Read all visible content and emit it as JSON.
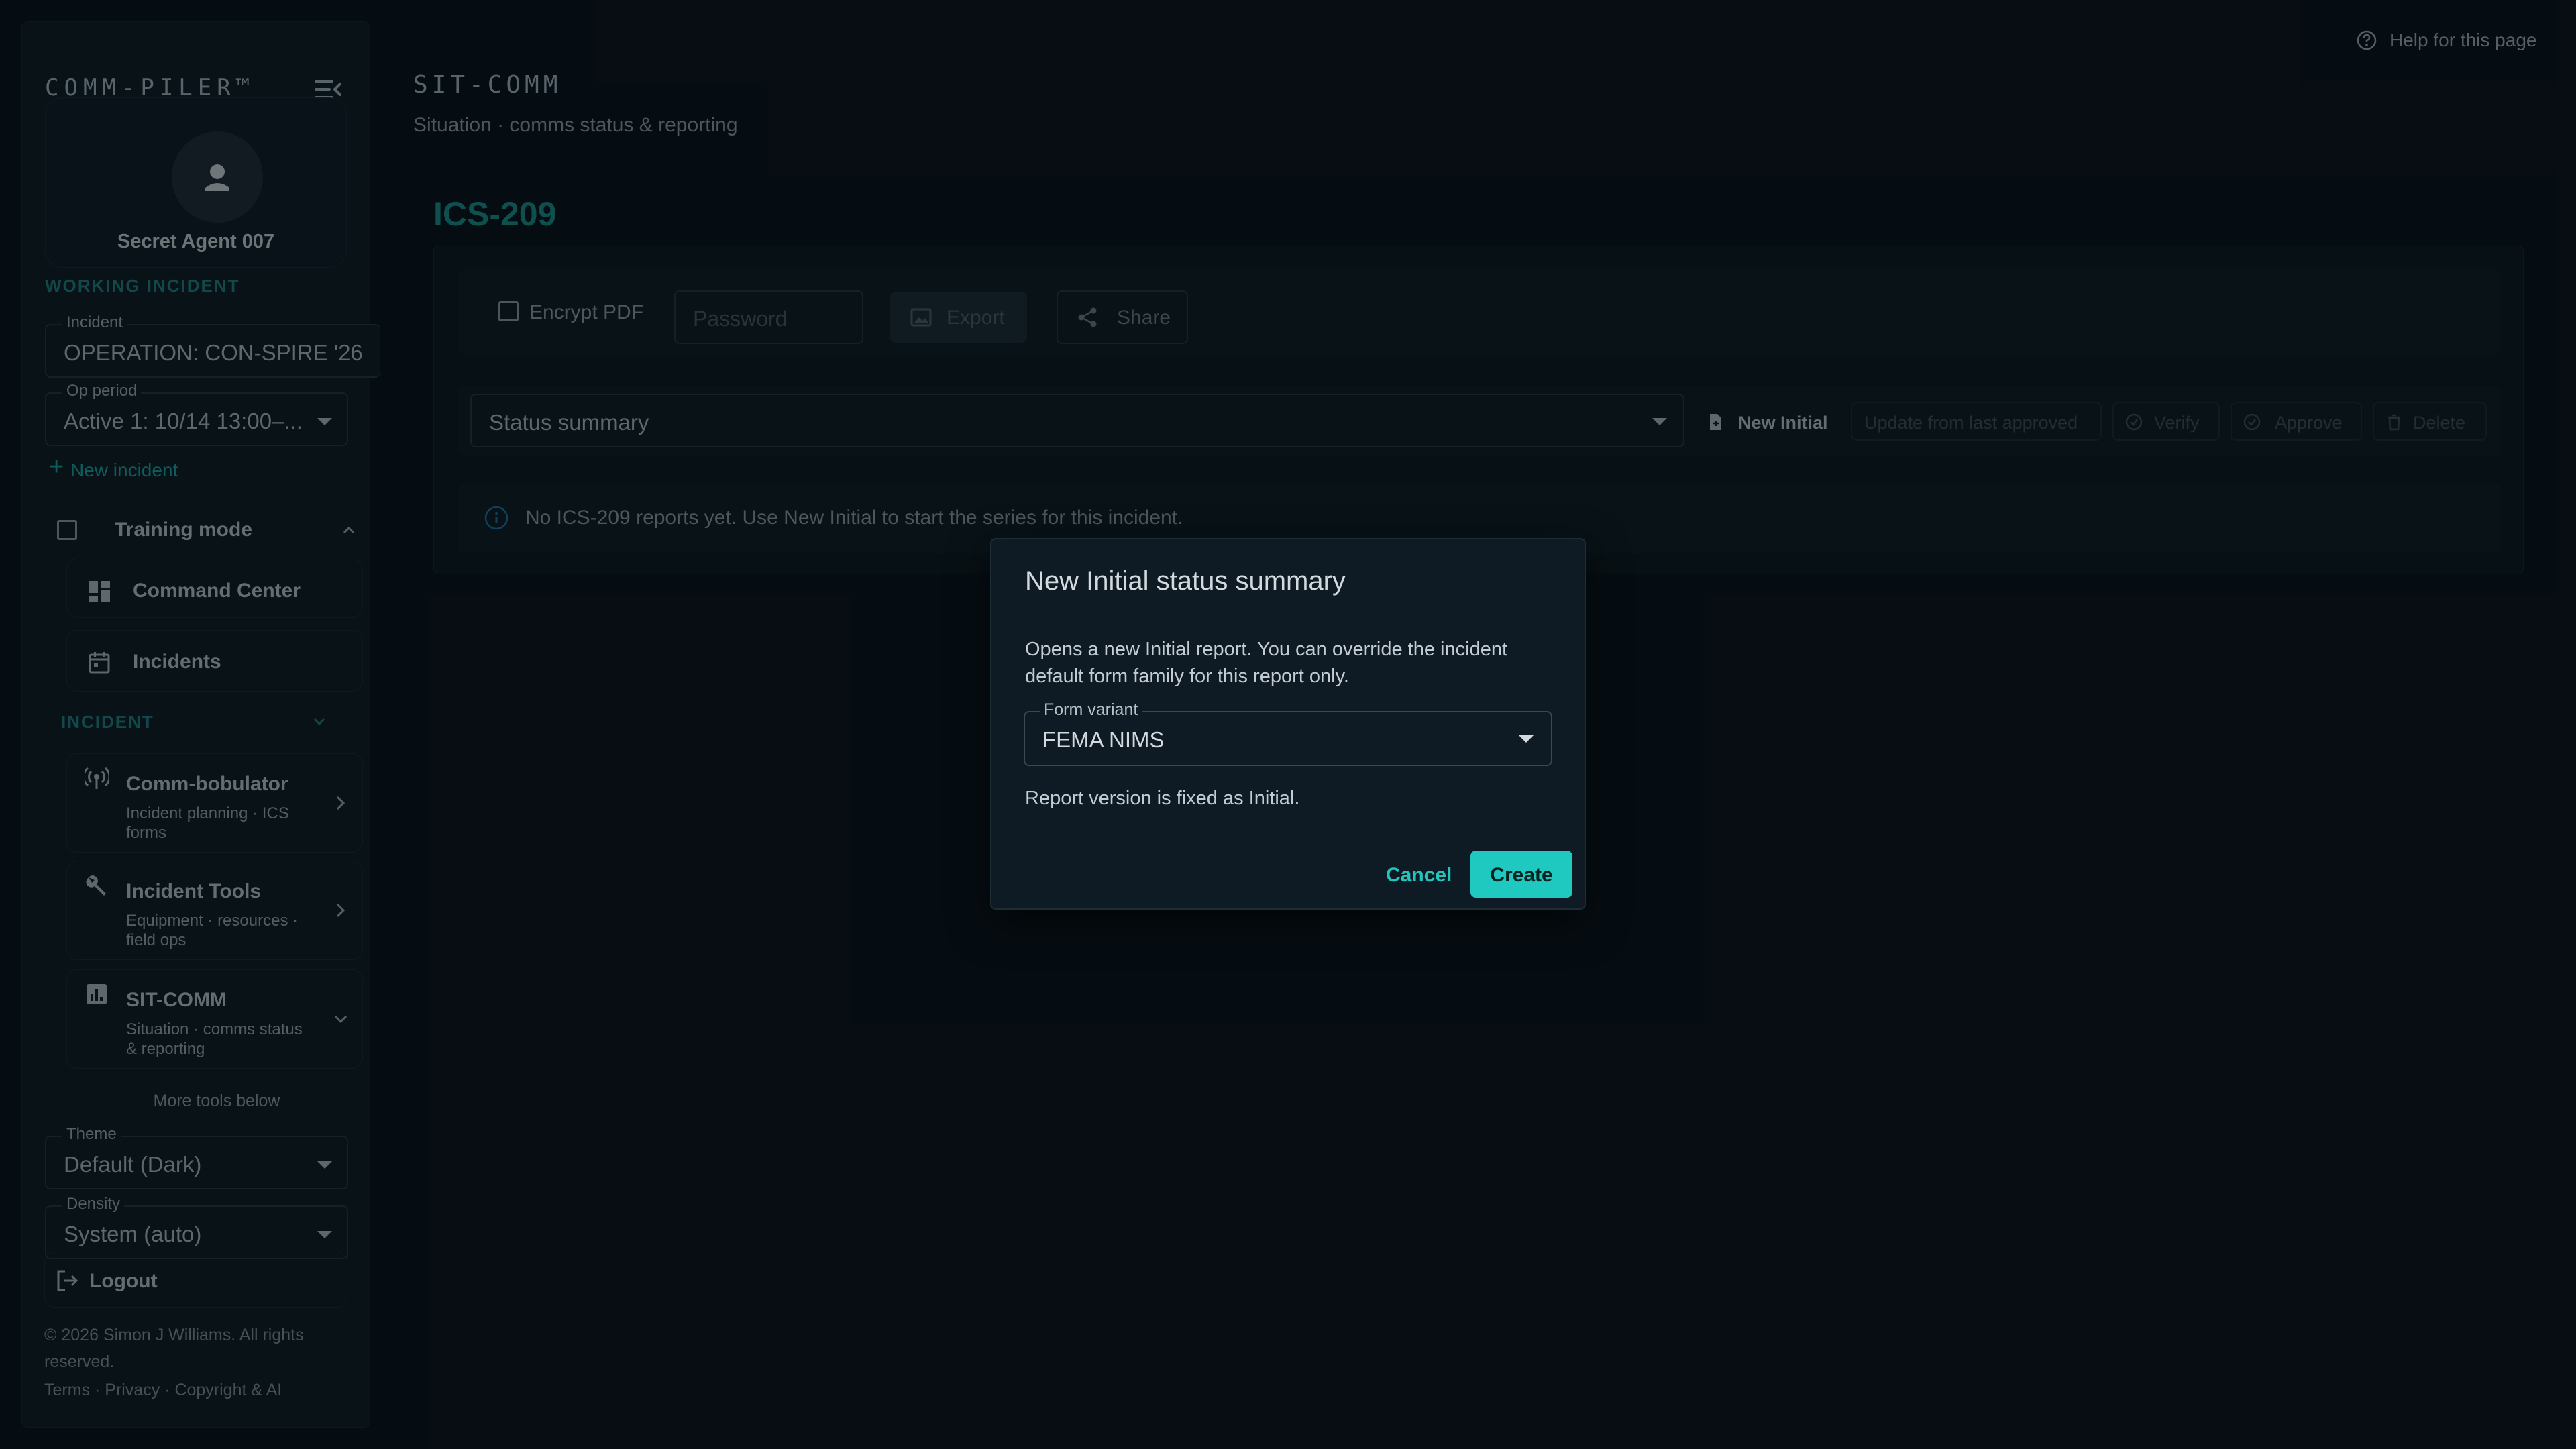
{
  "app": {
    "brand": "COMM-PILER™"
  },
  "profile": {
    "name": "Secret Agent 007"
  },
  "working_incident": {
    "section_label": "WORKING INCIDENT",
    "incident_label": "Incident",
    "incident_value": "OPERATION: CON-SPIRE '26",
    "op_period_label": "Op period",
    "op_period_value": "Active 1: 10/14 13:00–...",
    "new_incident": "New incident"
  },
  "training": {
    "label": "Training mode",
    "checked": false
  },
  "nav": {
    "command_center": "Command Center",
    "incidents": "Incidents",
    "incident_section": "INCIDENT",
    "items": [
      {
        "label": "Comm-bobulator",
        "sub": "Incident planning · ICS forms"
      },
      {
        "label": "Incident Tools",
        "sub": "Equipment · resources · field ops"
      },
      {
        "label": "SIT-COMM",
        "sub": "Situation · comms status & reporting"
      }
    ],
    "more_tools": "More tools below"
  },
  "settings": {
    "theme_label": "Theme",
    "theme_value": "Default (Dark)",
    "density_label": "Density",
    "density_value": "System (auto)"
  },
  "logout": "Logout",
  "footer": {
    "copyright": "© 2026 Simon J Williams. All rights reserved.",
    "links": "Terms · Privacy · Copyright & AI"
  },
  "header": {
    "help": "Help for this page",
    "kicker": "SIT-COMM",
    "subtitle": "Situation · comms status & reporting"
  },
  "main": {
    "title": "ICS-209",
    "encrypt_label": "Encrypt PDF",
    "password_placeholder": "Password",
    "export": "Export",
    "share": "Share",
    "status_select": "Status summary",
    "actions": {
      "new_initial": "New Initial",
      "update": "Update from last approved",
      "verify": "Verify",
      "approve": "Approve",
      "delete": "Delete"
    },
    "info": "No ICS-209 reports yet. Use New Initial to start the series for this incident."
  },
  "dialog": {
    "title": "New Initial status summary",
    "description": "Opens a new Initial report. You can override the incident default form family for this report only.",
    "form_variant_label": "Form variant",
    "form_variant_value": "FEMA NIMS",
    "note": "Report version is fixed as Initial.",
    "cancel": "Cancel",
    "create": "Create"
  },
  "colors": {
    "accent": "#1fc9c0",
    "accent_dim": "#178a86",
    "background": "#0a1218",
    "sidebar": "#0f1a22"
  }
}
